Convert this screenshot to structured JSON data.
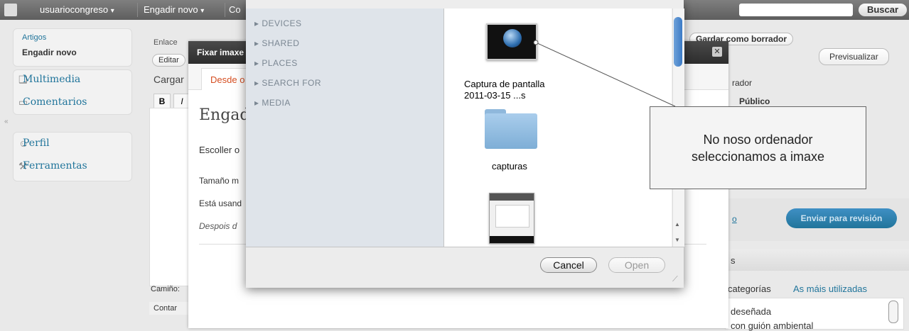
{
  "adminbar": {
    "user": "usuariocongreso",
    "add_new": "Engadir novo",
    "comments_partial": "Co",
    "search_button": "Buscar",
    "dropdown_glyph": "▾"
  },
  "leftmenu": {
    "posts_sub": [
      "Artigos",
      "Engadir novo"
    ],
    "items": [
      "Multimedia",
      "Comentarios",
      "Perfil",
      "Ferramentas"
    ],
    "collapse_glyph": "«"
  },
  "editor": {
    "link_label": "Enlace",
    "edit_btn": "Editar",
    "upload_label": "Cargar",
    "bold_btn": "B",
    "italic_btn": "I",
    "path_label": "Camiño:",
    "word_count": "Contar"
  },
  "rightpanel": {
    "save_draft": "Gardar como borrador",
    "preview": "Previsualizar",
    "status_partial": "rador",
    "visibility_partial": "Público",
    "submit": "Enviar para revisión",
    "box_letter": "s",
    "cats_tab": "categorías",
    "most_used_tab": "As máis utilizadas",
    "cat1": "deseñada",
    "cat2": "con guión ambiental",
    "link_partial": "o"
  },
  "modal": {
    "title": "Fixar imaxe",
    "tab_from_computer": "Desde o",
    "heading": "Engad",
    "choose": "Escoller o",
    "max_size": "Tamaño m",
    "using": "Está usand",
    "after": "Despois d"
  },
  "filedialog": {
    "sidebar": [
      "DEVICES",
      "SHARED",
      "PLACES",
      "SEARCH FOR",
      "MEDIA"
    ],
    "files": [
      {
        "name_line1": "Captura de pantalla",
        "name_line2": "2011-03-15 ...s",
        "kind": "screenshot"
      },
      {
        "name_line1": "capturas",
        "name_line2": "",
        "kind": "folder"
      },
      {
        "name_line1": "",
        "name_line2": "",
        "kind": "screenshot"
      }
    ],
    "cancel": "Cancel",
    "open": "Open"
  },
  "callout": {
    "line1": "No noso ordenador",
    "line2": "seleccionamos a imaxe"
  }
}
